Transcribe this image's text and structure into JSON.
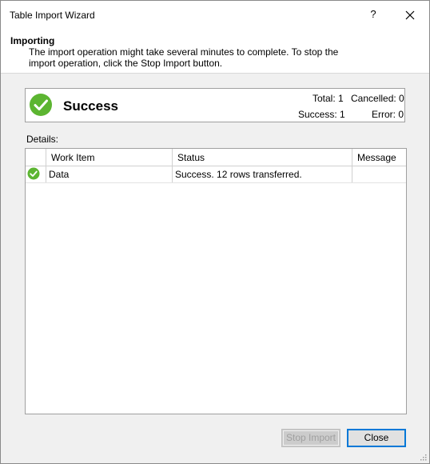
{
  "window": {
    "title": "Table Import Wizard",
    "help_label": "?"
  },
  "header": {
    "heading": "Importing",
    "description": "The import operation might take several minutes to complete. To stop the import operation, click the Stop Import button."
  },
  "status": {
    "text": "Success",
    "total_label": "Total: 1",
    "cancelled_label": "Cancelled: 0",
    "success_label": "Success: 1",
    "error_label": "Error: 0"
  },
  "details": {
    "label": "Details:",
    "columns": [
      "Work Item",
      "Status",
      "Message"
    ],
    "rows": [
      {
        "work_item": "Data",
        "status": "Success. 12 rows transferred.",
        "message": "",
        "icon": "success-check-icon"
      }
    ]
  },
  "buttons": {
    "stop_import": "Stop Import",
    "close": "Close"
  },
  "colors": {
    "success_green": "#5cb531",
    "accent_blue": "#0078d7"
  }
}
